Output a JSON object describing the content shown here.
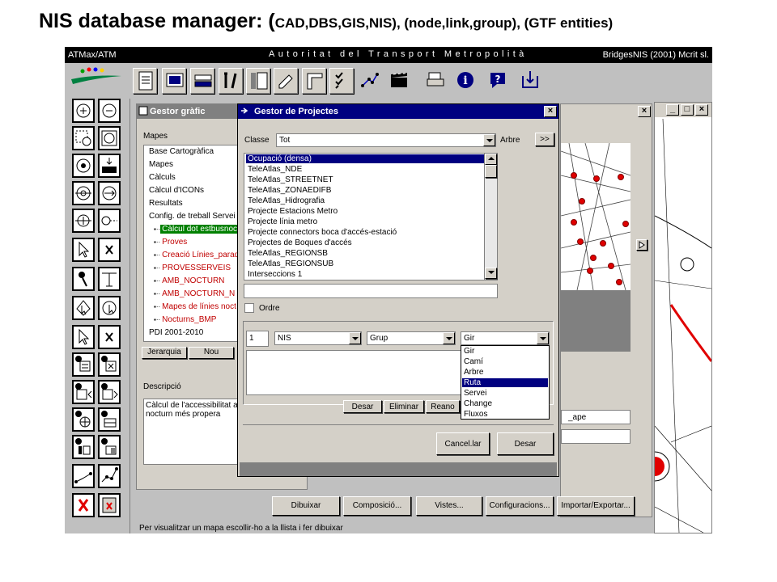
{
  "slide_title": {
    "main": "NIS database manager: (",
    "rest": "CAD,DBS,GIS,NIS), (node,link,group), (GTF entities)"
  },
  "app": {
    "title_left": "ATMax/ATM",
    "title_center": "Autoritat del Transport Metropolità",
    "title_right": "BridgesNIS (2001) Mcrit sl."
  },
  "gestor_grafic": {
    "title": "Gestor gràfic",
    "close": "×",
    "mapes_label": "Mapes",
    "tree": [
      {
        "label": "Base Cartogràfica",
        "indent": 0,
        "style": "normal"
      },
      {
        "label": "Mapes",
        "indent": 0,
        "style": "normal"
      },
      {
        "label": "Càlculs",
        "indent": 0,
        "style": "normal"
      },
      {
        "label": "Càlcul d'ICONs",
        "indent": 0,
        "style": "normal"
      },
      {
        "label": "Resultats",
        "indent": 0,
        "style": "normal"
      },
      {
        "label": "Config. de treball Servei",
        "indent": 0,
        "style": "normal"
      },
      {
        "label": "Càlcul dot estbusnoc",
        "indent": 1,
        "style": "selected"
      },
      {
        "label": "Proves",
        "indent": 1,
        "style": "red"
      },
      {
        "label": "Creació Línies_parad",
        "indent": 1,
        "style": "red"
      },
      {
        "label": "PROVESSERVEIS",
        "indent": 1,
        "style": "red"
      },
      {
        "label": "AMB_NOCTURN",
        "indent": 1,
        "style": "red"
      },
      {
        "label": "AMB_NOCTURN_N",
        "indent": 1,
        "style": "red"
      },
      {
        "label": "Mapes de línies noct",
        "indent": 1,
        "style": "red"
      },
      {
        "label": "Nocturns_BMP",
        "indent": 1,
        "style": "red"
      },
      {
        "label": "PDI 2001-2010",
        "indent": 0,
        "style": "normal"
      }
    ],
    "btn_jerarquia": "Jerarquia",
    "btn_nou": "Nou",
    "descripcio_label": "Descripció",
    "descripcio_text": "Càlcul de l'accessibilitat a\nnocturn més propera"
  },
  "gestor_projectes": {
    "title": "Gestor de Projectes",
    "close": "×",
    "classe_label": "Classe",
    "classe_value": "Tot",
    "arbre_label": "Arbre",
    "arbre_btn": ">>",
    "projects": [
      "Ocupació (densa)",
      "TeleAtlas_NDE",
      "TeleAtlas_STREETNET",
      "TeleAtlas_ZONAEDIFB",
      "TeleAtlas_Hidrografia",
      "Projecte Estacions Metro",
      "Projecte línia metro",
      "Projecte connectors boca d'accés-estació",
      "Projectes de Boques d'accés",
      "TeleAtlas_REGIONSB",
      "TeleAtlas_REGIONSUB",
      "Interseccions 1"
    ],
    "selected_index": 0,
    "ordre_label": "Ordre",
    "field_value": "1",
    "combo_nis": "NIS",
    "combo_grup": "Grup",
    "combo_gir": "Gir",
    "dropdown": [
      "Gir",
      "Camí",
      "Arbre",
      "Ruta",
      "Servei",
      "Change",
      "Fluxos"
    ],
    "dropdown_selected": 3,
    "btn_desar_small": "Desar",
    "btn_eliminar": "Eliminar",
    "btn_reanomenar": "Reano",
    "btn_cancelar": "Cancel.lar",
    "btn_desar": "Desar"
  },
  "map_window": {
    "close": "×",
    "side_text": "_ape"
  },
  "bottom_buttons": [
    "Dibuixar",
    "Composició...",
    "Vistes...",
    "Configuracions...",
    "Importar/Exportar..."
  ],
  "status": "Per visualitzar un mapa escollir-ho a la llista i fer dibuixar",
  "outer_window": {
    "min": "_",
    "max": "□",
    "close": "×"
  }
}
